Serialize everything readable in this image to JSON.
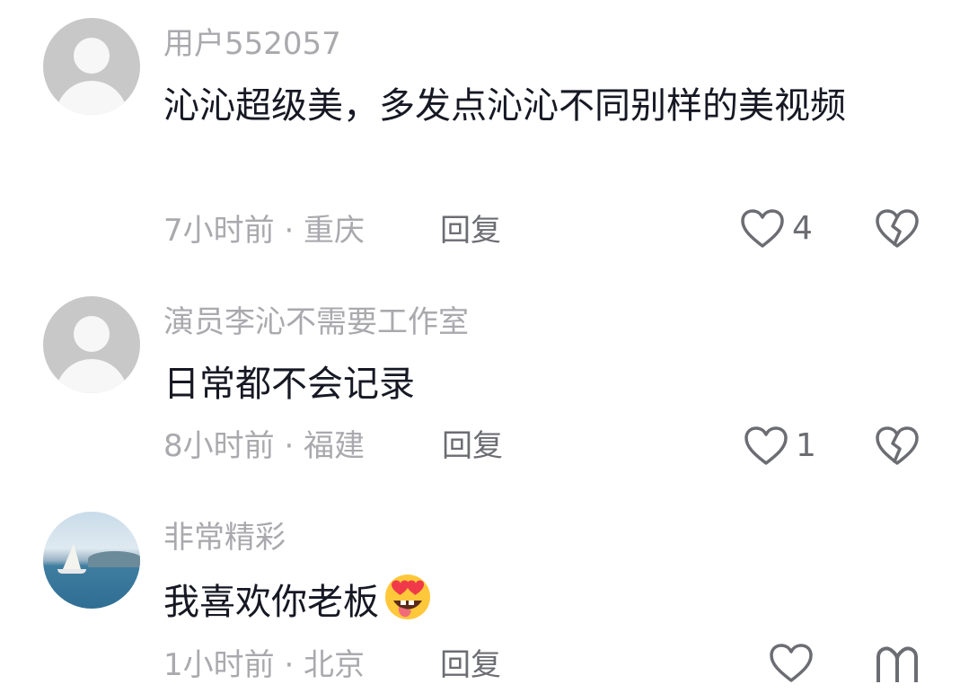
{
  "comments": [
    {
      "username": "用户552057",
      "text": "沁沁超级美，多发点沁沁不同别样的美视频",
      "meta": "7小时前 · 重庆",
      "reply_label": "回复",
      "like_count": "4",
      "avatar": "default-avatar"
    },
    {
      "username": "演员李沁不需要工作室",
      "text": "日常都不会记录",
      "meta": "8小时前 · 福建",
      "reply_label": "回复",
      "like_count": "1",
      "avatar": "default-avatar"
    },
    {
      "username": "非常精彩",
      "text": "我喜欢你老板",
      "meta": "1小时前 · 北京",
      "reply_label": "回复",
      "avatar": "sailboat-photo-avatar",
      "emoji": "heart-eyes-tongue-emoji"
    }
  ],
  "colors": {
    "username": "#a9a9ae",
    "text": "#161823",
    "meta": "#a9a9ae",
    "action": "#6c6d73"
  },
  "icons": {
    "like": "heart-outline-icon",
    "dislike": "broken-heart-icon"
  }
}
